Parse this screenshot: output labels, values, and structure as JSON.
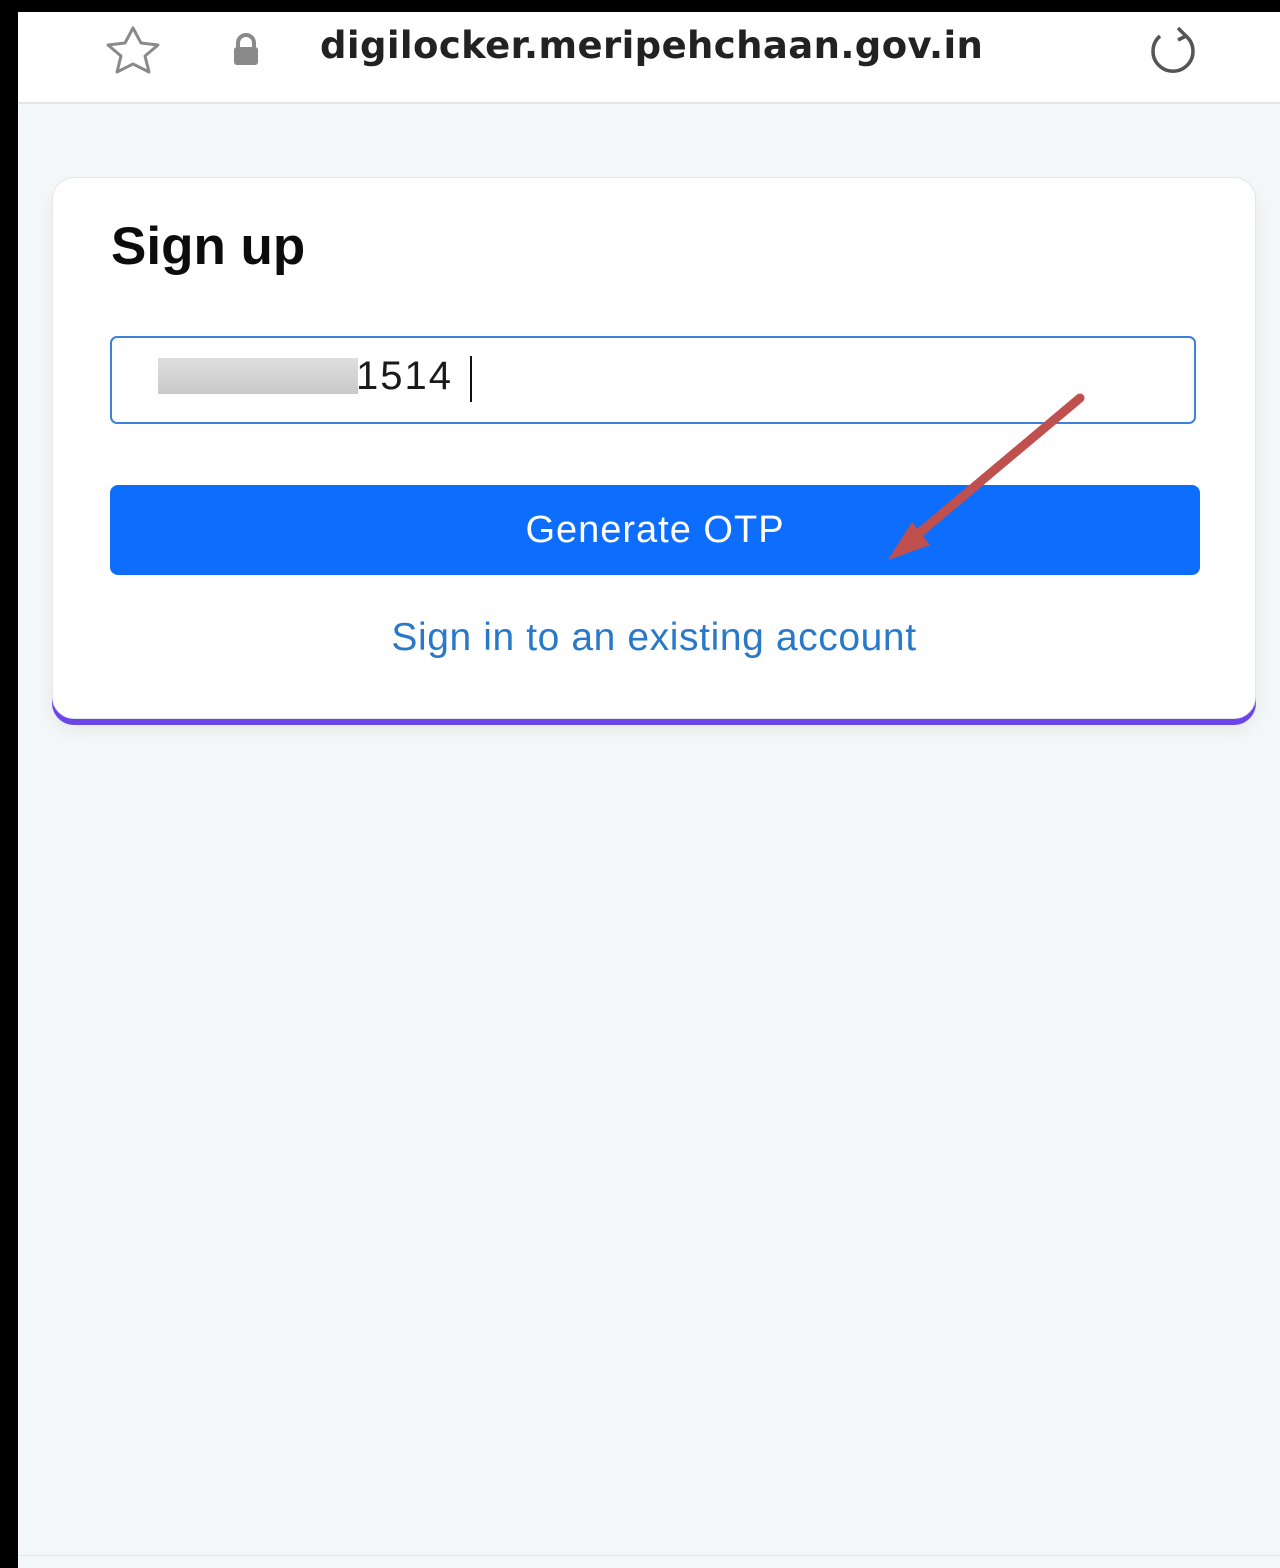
{
  "browser": {
    "url": "digilocker.meripehchaan.gov.in"
  },
  "signup": {
    "title": "Sign up",
    "phone_value_visible": "1514",
    "generate_otp_label": "Generate OTP",
    "signin_link": "Sign in to an existing account"
  },
  "colors": {
    "primary_button": "#0d6efd",
    "link": "#2a78c8",
    "card_accent": "#6c45e8",
    "annotation_arrow": "#c0504d"
  },
  "icons": [
    "star-icon",
    "lock-icon",
    "reload-icon"
  ]
}
